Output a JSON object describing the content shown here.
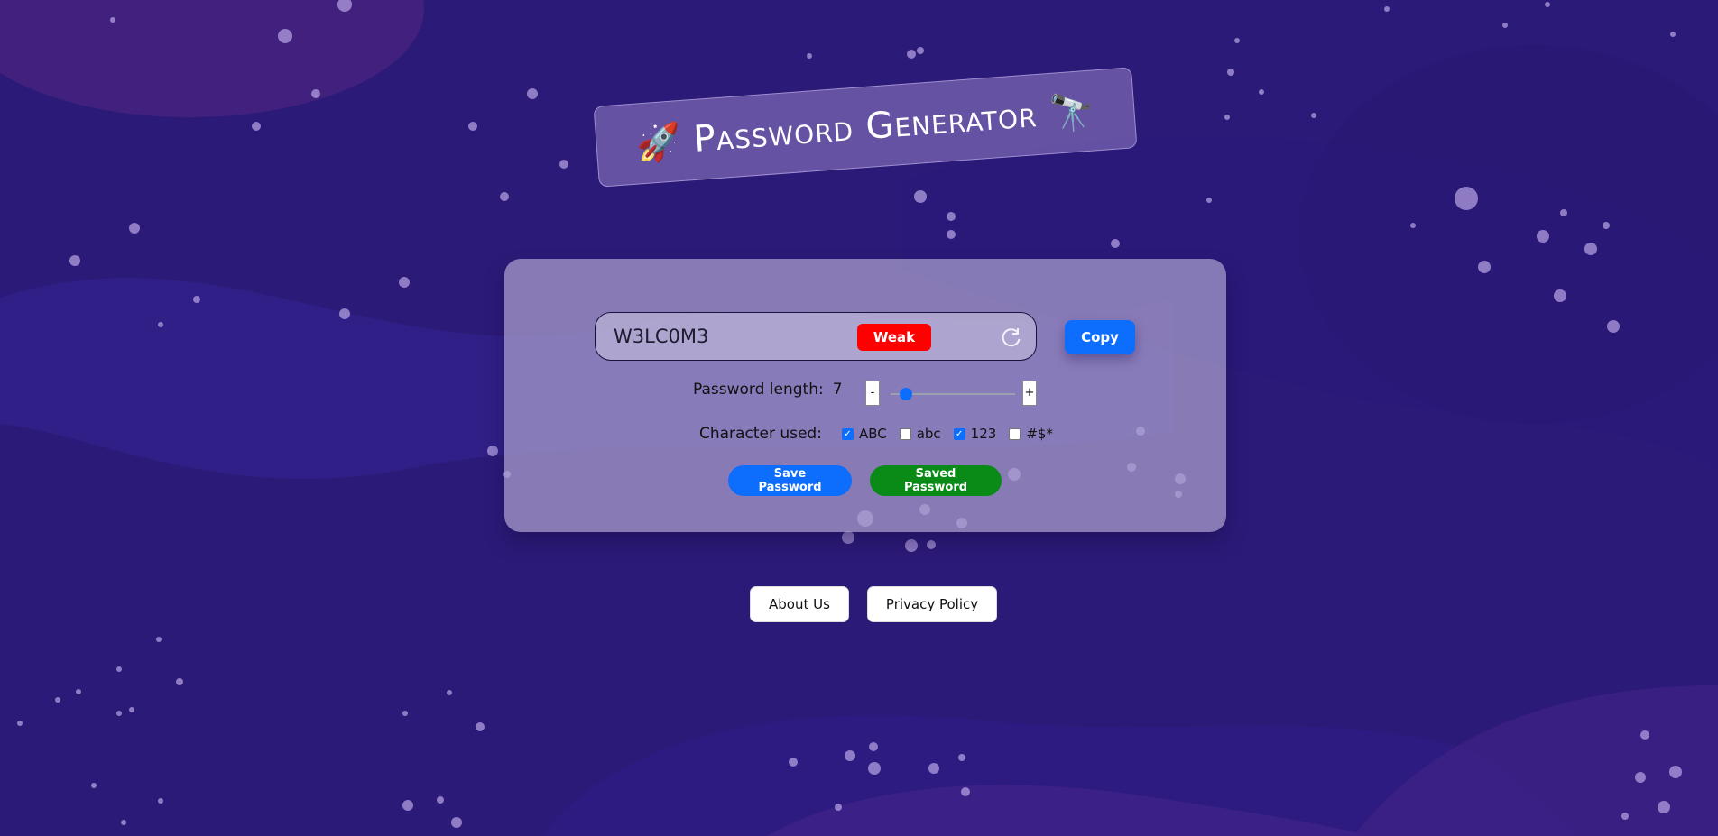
{
  "header": {
    "title": "Password Generator",
    "left_icon": "rocket-icon",
    "right_icon": "telescope-icon"
  },
  "generator": {
    "password_value": "W3LC0M3",
    "strength_label": "Weak",
    "strength_color": "#ff0000",
    "copy_label": "Copy",
    "length_label": "Password length:",
    "length_value": "7",
    "decrement_label": "-",
    "increment_label": "+",
    "length_slider_fraction": 0.12,
    "characters_label": "Character used:",
    "options": [
      {
        "label": "ABC",
        "checked": true
      },
      {
        "label": "abc",
        "checked": false
      },
      {
        "label": "123",
        "checked": true
      },
      {
        "label": "#$*",
        "checked": false
      }
    ],
    "save_label": "Save Password",
    "saved_label": "Saved Password"
  },
  "footer": {
    "about_label": "About Us",
    "privacy_label": "Privacy Policy"
  },
  "colors": {
    "background": "#2c1a78",
    "accent_blue": "#0d6efd",
    "saved_green": "#0a8a16"
  }
}
